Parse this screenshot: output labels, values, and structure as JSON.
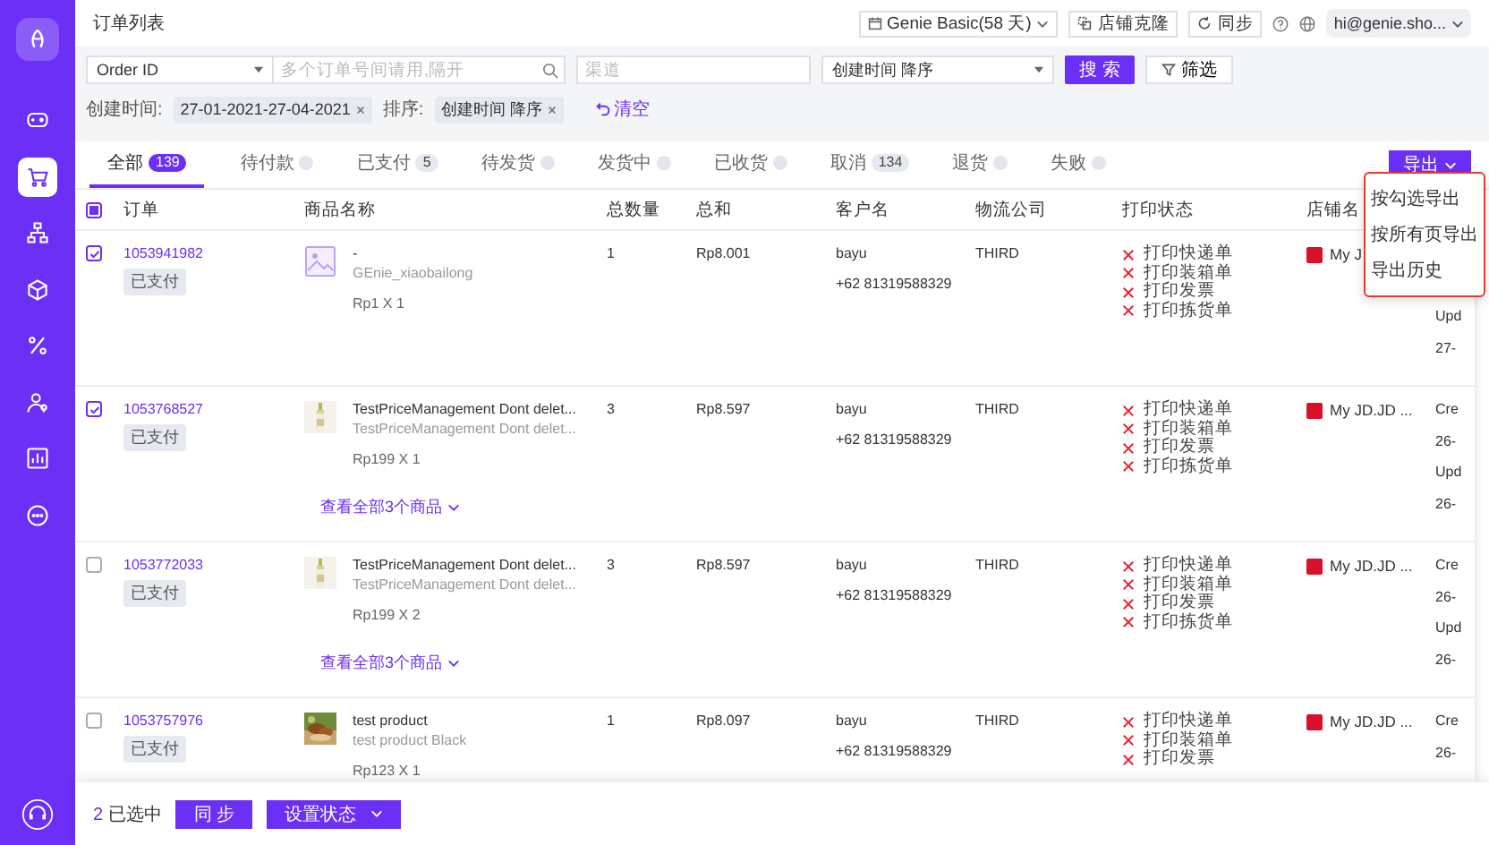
{
  "page_title": "订单列表",
  "header": {
    "plan": "Genie Basic(58 天)",
    "clone_button": "店铺克隆",
    "sync_button": "同步",
    "account": "hi@genie.sho..."
  },
  "sidebar": {
    "items": [
      {
        "selected": false
      },
      {
        "selected": true
      },
      {
        "selected": false
      },
      {
        "selected": false
      },
      {
        "selected": false
      },
      {
        "selected": false
      },
      {
        "selected": false
      },
      {
        "selected": false
      }
    ]
  },
  "filters": {
    "field_select": "Order ID",
    "order_search": {
      "placeholder": "多个订单号间请用,隔开"
    },
    "channel": {
      "placeholder": "渠道"
    },
    "sort_select": "创建时间 降序",
    "search_button": "搜 索",
    "filter_button": "筛选",
    "chips": [
      {
        "label": "创建时间:",
        "value": "27-01-2021-27-04-2021"
      },
      {
        "label": "排序:",
        "value": "创建时间 降序"
      }
    ],
    "clear_link": "清空"
  },
  "tabs": [
    {
      "label": "全部",
      "count": "139",
      "selected": true
    },
    {
      "label": "待付款",
      "selected": false
    },
    {
      "label": "已支付",
      "count": "5",
      "selected": false
    },
    {
      "label": "待发货",
      "selected": false
    },
    {
      "label": "发货中",
      "selected": false
    },
    {
      "label": "已收货",
      "selected": false
    },
    {
      "label": "取消",
      "count": "134",
      "selected": false
    },
    {
      "label": "退货",
      "selected": false
    },
    {
      "label": "失败",
      "selected": false
    }
  ],
  "export": {
    "label": "导出",
    "expanded": true,
    "highlighted": true,
    "items": [
      "按勾选导出",
      "按所有页导出",
      "导出历史"
    ]
  },
  "table": {
    "select_all": {
      "partial": true
    },
    "columns": [
      "订单",
      "商品名称",
      "总数量",
      "总和",
      "客户名",
      "物流公司",
      "打印状态",
      "店铺名"
    ],
    "rows": [
      {
        "checked": true,
        "order_no": "1053941982",
        "status": "已支付",
        "product": {
          "image": {
            "kind": "placeholder"
          },
          "name": "-",
          "variant": "GEnie_xiaobailong",
          "price": "Rp1 X 1"
        },
        "quantity": "1",
        "total": "Rp8.001",
        "customer": "bayu",
        "phone": "+62 81319588329",
        "carrier": "THIRD",
        "print_status": [
          {
            "label": "打印快递单",
            "done": false
          },
          {
            "label": "打印装箱单",
            "done": false
          },
          {
            "label": "打印发票",
            "done": false
          },
          {
            "label": "打印拣货单",
            "done": false
          }
        ],
        "store": "My J",
        "dates": [
          {
            "kind": "updated",
            "label": "Upd",
            "value": "27-"
          }
        ]
      },
      {
        "checked": true,
        "order_no": "1053768527",
        "status": "已支付",
        "product": {
          "image": {
            "kind": "bottle_photo"
          },
          "name": "TestPriceManagement Dont delet...",
          "variant": "TestPriceManagement Dont delet...",
          "price": "Rp199 X 1"
        },
        "more_link": "查看全部3个商品",
        "quantity": "3",
        "total": "Rp8.597",
        "customer": "bayu",
        "phone": "+62 81319588329",
        "carrier": "THIRD",
        "print_status": [
          {
            "label": "打印快递单",
            "done": false
          },
          {
            "label": "打印装箱单",
            "done": false
          },
          {
            "label": "打印发票",
            "done": false
          },
          {
            "label": "打印拣货单",
            "done": false
          }
        ],
        "store": "My JD.JD ...",
        "dates": [
          {
            "kind": "created",
            "label": "Cre",
            "value": "26-"
          },
          {
            "kind": "updated",
            "label": "Upd",
            "value": "26-"
          }
        ]
      },
      {
        "checked": false,
        "order_no": "1053772033",
        "status": "已支付",
        "product": {
          "image": {
            "kind": "bottle_photo"
          },
          "name": "TestPriceManagement Dont delet...",
          "variant": "TestPriceManagement Dont delet...",
          "price": "Rp199 X 2"
        },
        "more_link": "查看全部3个商品",
        "quantity": "3",
        "total": "Rp8.597",
        "customer": "bayu",
        "phone": "+62 81319588329",
        "carrier": "THIRD",
        "print_status": [
          {
            "label": "打印快递单",
            "done": false
          },
          {
            "label": "打印装箱单",
            "done": false
          },
          {
            "label": "打印发票",
            "done": false
          },
          {
            "label": "打印拣货单",
            "done": false
          }
        ],
        "store": "My JD.JD ...",
        "dates": [
          {
            "kind": "created",
            "label": "Cre",
            "value": "26-"
          },
          {
            "kind": "updated",
            "label": "Upd",
            "value": "26-"
          }
        ]
      },
      {
        "checked": false,
        "order_no": "1053757976",
        "status": "已支付",
        "product": {
          "image": {
            "kind": "food_photo"
          },
          "name": "test product",
          "variant": "test product Black",
          "price": "Rp123 X 1"
        },
        "quantity": "1",
        "total": "Rp8.097",
        "customer": "bayu",
        "phone": "+62 81319588329",
        "carrier": "THIRD",
        "print_status": [
          {
            "label": "打印快递单",
            "done": false
          },
          {
            "label": "打印装箱单",
            "done": false
          },
          {
            "label": "打印发票",
            "done": false
          }
        ],
        "store": "My JD.JD ...",
        "dates": [
          {
            "kind": "created",
            "label": "Cre",
            "value": "26-"
          }
        ]
      }
    ]
  },
  "bottom_bar": {
    "selected_count": "2",
    "selected_label": "已选中",
    "sync_button": "同 步",
    "status_button": "设置状态"
  }
}
